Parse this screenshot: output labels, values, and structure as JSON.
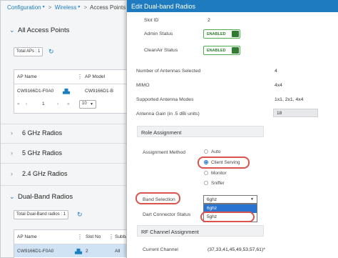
{
  "breadcrumb": {
    "item1": "Configuration",
    "item2": "Wireless",
    "current": "Access Points"
  },
  "all_aps": {
    "title": "All Access Points",
    "total_label": "Total APs : 1",
    "col_name": "AP Name",
    "col_model": "AP Model",
    "row_name": "CW9166D1-F0A0",
    "row_model": "CW9166D1-B",
    "pager_first": "«",
    "pager_prev": "‹",
    "pager_page": "1",
    "pager_next": "›",
    "pager_last": "»",
    "per_page": "10"
  },
  "radio_sections": [
    "6 GHz Radios",
    "5 GHz Radios",
    "2.4 GHz Radios"
  ],
  "dual_band": {
    "title": "Dual-Band Radios",
    "total_label": "Total Dual-Band radios : 1",
    "col_name": "AP Name",
    "col_slot": "Slot No",
    "col_sub": "Subba",
    "row_name": "CW9166D1-F0A0",
    "row_slot": "2",
    "row_sub": "All"
  },
  "modal": {
    "title": "Edit Dual-band Radios",
    "slot_id_label": "Slot ID",
    "slot_id_value": "2",
    "admin_label": "Admin Status",
    "admin_value": "ENABLED",
    "cleanair_label": "CleanAir Status",
    "cleanair_value": "ENABLED",
    "antennas_label": "Number of Antennas Selected",
    "antennas_value": "4",
    "mimo_label": "MIMO",
    "mimo_value": "4x4",
    "modes_label": "Supported Antenna Modes",
    "modes_value": "1x1, 2x1, 4x4",
    "gain_label": "Antenna Gain (in .5 dBi units)",
    "gain_value": "18",
    "role_section": "Role Assignment",
    "method_label": "Assignment Method",
    "method_options": [
      "Auto",
      "Client Serving",
      "Monitor",
      "Sniffer"
    ],
    "method_selected": "Client Serving",
    "band_label": "Band Selection",
    "band_value": "6ghz",
    "band_options": [
      "6ghz",
      "5ghz"
    ],
    "dart_label": "Dart Connector Status",
    "rf_section": "RF Channel Assignment",
    "channel_label": "Current Channel",
    "channel_value": "(37,33,41,45,49,53,57,61)*"
  },
  "colors": {
    "accent": "#1f7bbf",
    "enabled": "#2e7d32",
    "highlight": "#d9534f",
    "selected_option": "#2a73d0"
  }
}
